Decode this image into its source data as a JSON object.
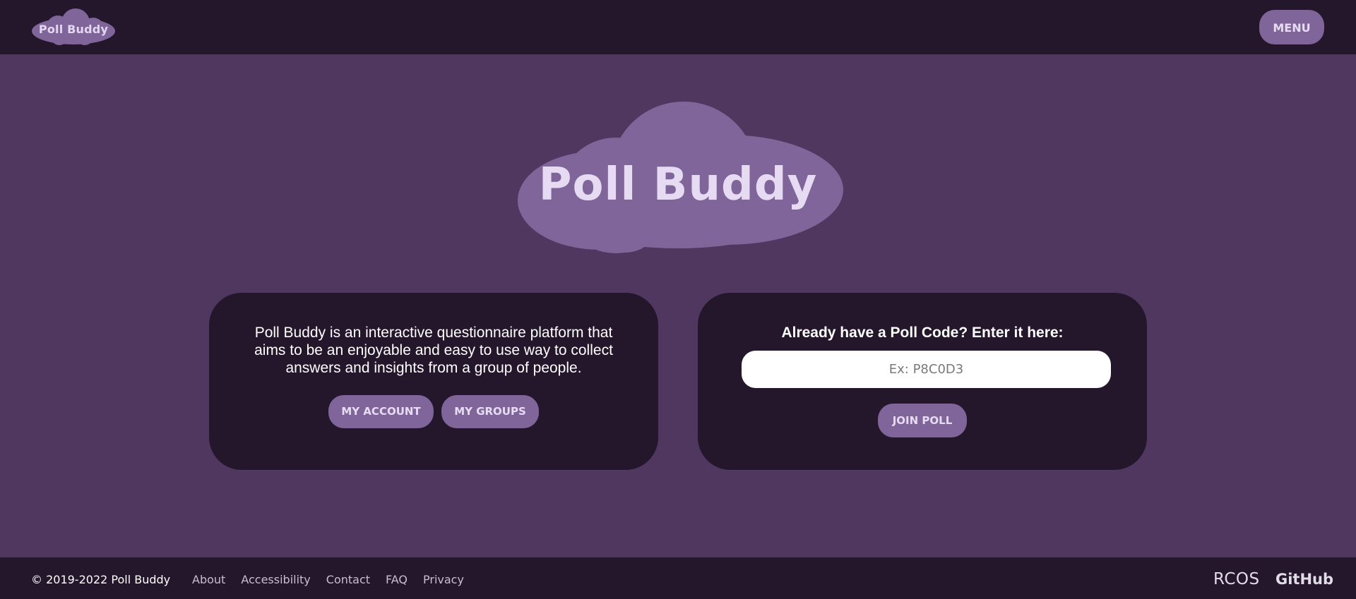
{
  "header": {
    "logo_text": "Poll Buddy",
    "menu_label": "MENU"
  },
  "hero": {
    "title": "Poll Buddy"
  },
  "intro": {
    "description": "Poll Buddy is an interactive questionnaire platform that aims to be an enjoyable and easy to use way to collect answers and insights from a group of people.",
    "my_account_label": "MY ACCOUNT",
    "my_groups_label": "MY GROUPS"
  },
  "join": {
    "heading": "Already have a Poll Code? Enter it here:",
    "placeholder": "Ex: P8C0D3",
    "value": "",
    "join_label": "JOIN POLL"
  },
  "footer": {
    "copyright": "© 2019-2022 Poll Buddy",
    "links": [
      "About",
      "Accessibility",
      "Contact",
      "FAQ",
      "Privacy"
    ],
    "rcos_label": "RCOS",
    "github_label": "GitHub"
  },
  "colors": {
    "page_background": "#4f3760",
    "bar_background": "#24162b",
    "card_background": "#24162b",
    "accent": "#80659a",
    "logo_text": "#e7daf3"
  }
}
